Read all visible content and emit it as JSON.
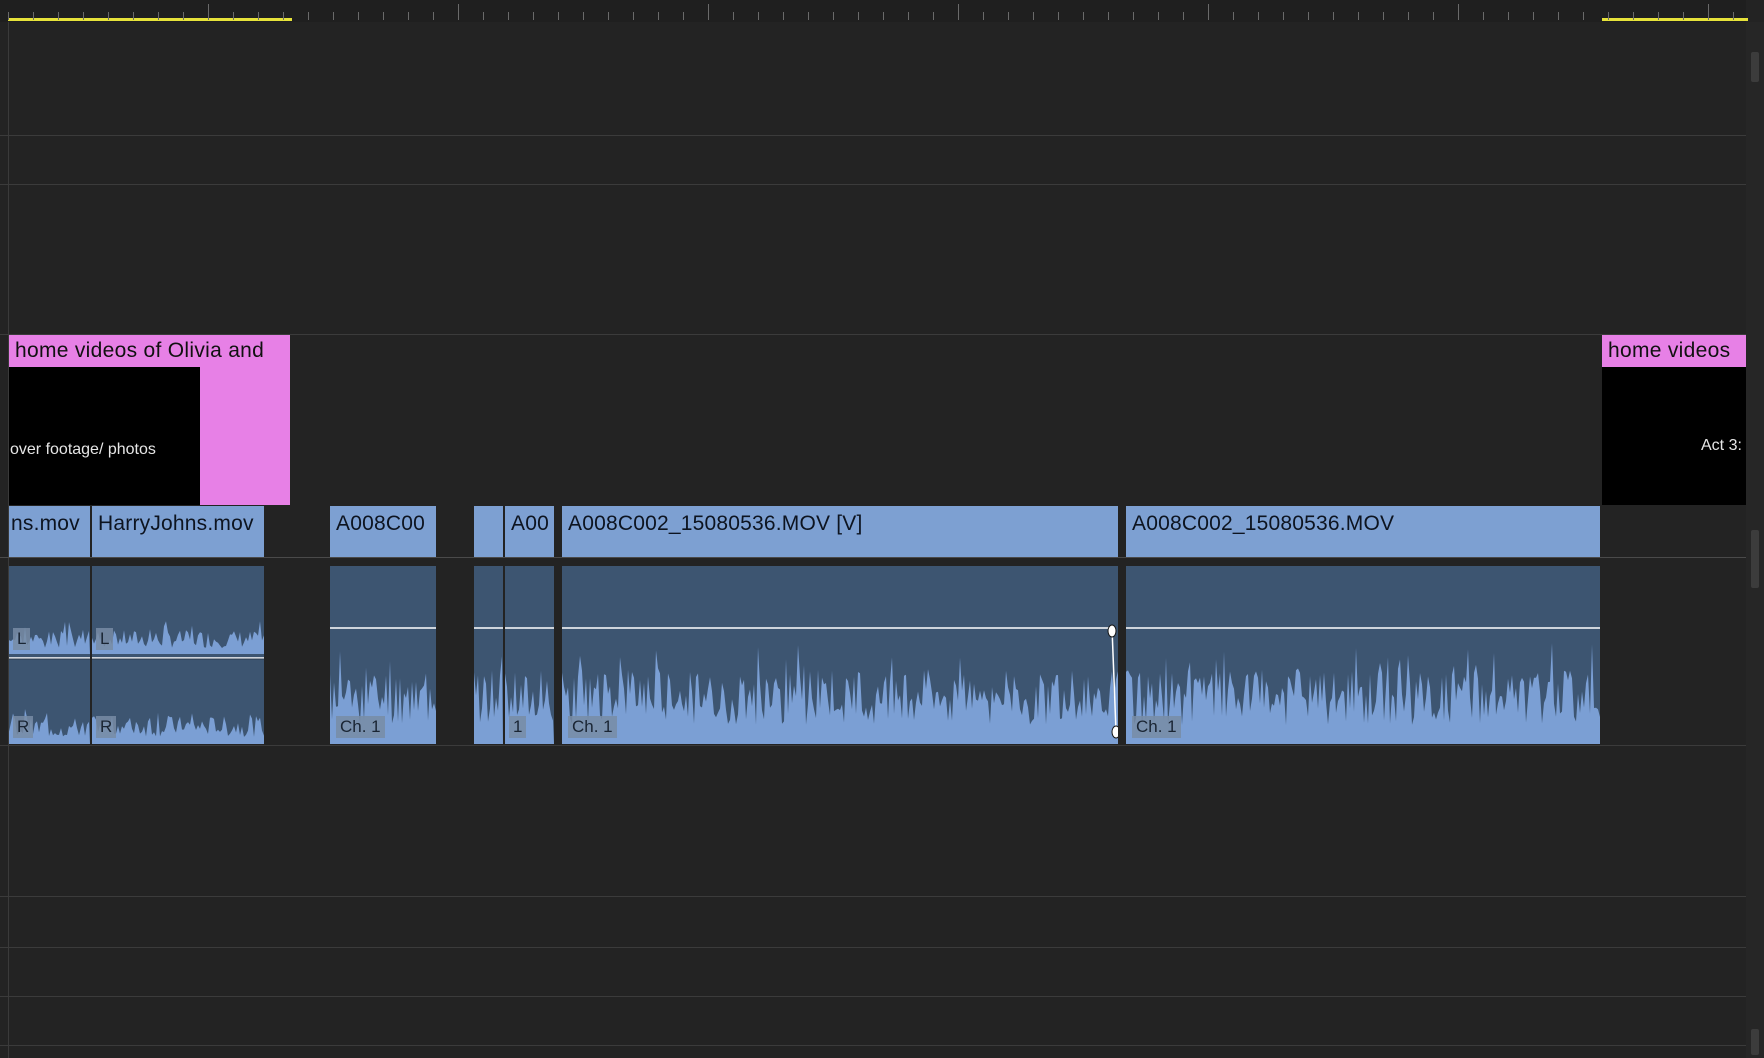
{
  "app": {
    "panel": "timeline"
  },
  "colors": {
    "background": "#232323",
    "title_clip": "#e780e6",
    "video_clip": "#7da0d2",
    "audio_clip": "#3d5571",
    "waveform": "#7b9fd4",
    "in_out_marker": "#e6e23a"
  },
  "title_clips": [
    {
      "head": "home videos of Olivia and",
      "body": "over footage/ photos"
    },
    {
      "head": "home videos",
      "body": "Act 3:"
    }
  ],
  "video_clips": [
    {
      "name": "ns.mov"
    },
    {
      "name": "HarryJohns.mov"
    },
    {
      "name": "A008C00"
    },
    {
      "name": ""
    },
    {
      "name": "A00"
    },
    {
      "name": "A008C002_15080536.MOV [V]"
    },
    {
      "name": "A008C002_15080536.MOV"
    }
  ],
  "audio_clips": [
    {
      "labels": [
        "L",
        "R"
      ]
    },
    {
      "labels": [
        "L",
        "R"
      ]
    },
    {
      "labels": [
        "Ch. 1"
      ]
    },
    {
      "labels": []
    },
    {
      "labels": [
        "1"
      ]
    },
    {
      "labels": [
        "Ch. 1"
      ]
    },
    {
      "labels": [
        "Ch. 1"
      ]
    }
  ]
}
